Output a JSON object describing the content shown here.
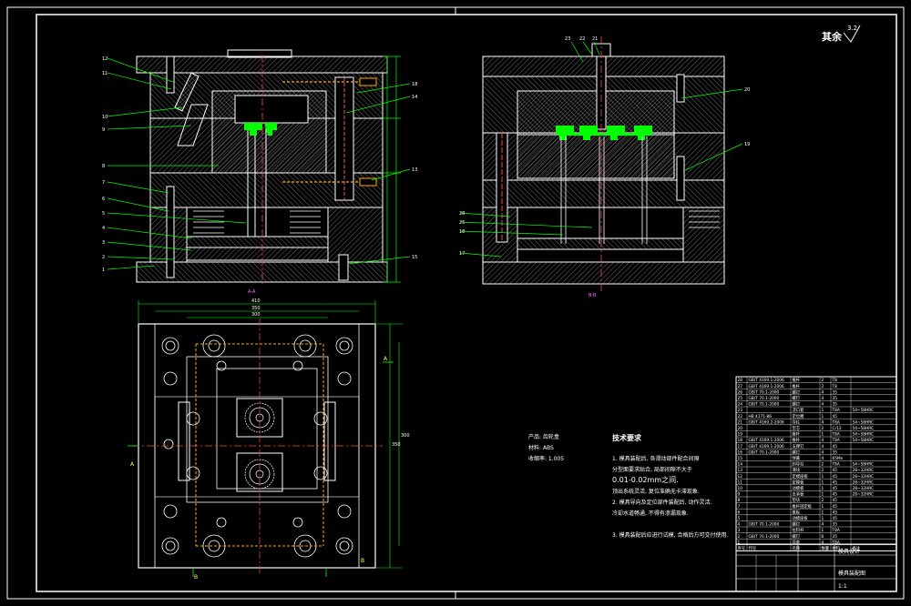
{
  "title_block": {
    "roughness_label": "其余",
    "roughness_value": "3.2",
    "dept": "模具设计",
    "drawing_name": "模具装配图",
    "scale": "1:1"
  },
  "product_info": {
    "product": "产品: 齿轮盒",
    "material": "材料: ABS",
    "shrink": "收缩率: 1.005"
  },
  "tech_req": {
    "heading": "技术要求",
    "lines": [
      "1. 模具装配后, 各滑动部件配合间隙",
      "分型面要求贴合, 局部间隙不大于",
      "0.01-0.02mm之间.",
      "顶出系统灵活, 复位准确无卡滞现象.",
      "2. 模具导向及定位部件装配后, 动作灵活.",
      "冷却水道畅通, 不得有渗漏现象.",
      "3. 模具装配后应进行试模, 合格后方可交付使用."
    ]
  },
  "views": {
    "section_a": "A-A",
    "section_b": "B-B",
    "marker_a": "A",
    "marker_b": "B"
  },
  "balloons_left": [
    "12",
    "11",
    "10",
    "9",
    "8",
    "7",
    "6",
    "5",
    "4",
    "3",
    "2",
    "1"
  ],
  "balloons_left_right": [
    "18",
    "14",
    "13",
    "15"
  ],
  "balloons_right_top": [
    "23",
    "22",
    "21"
  ],
  "balloons_right_side": [
    "20",
    "19"
  ],
  "balloons_right_left": [
    "28",
    "25",
    "18",
    "17"
  ],
  "dims": {
    "w1": "410",
    "w2": "350",
    "w3": "300",
    "h1": "350",
    "h2": "300"
  },
  "bom_rows": [
    [
      "28",
      "GB/T 4169.1-2006",
      "推杆",
      "2",
      "T8",
      ""
    ],
    [
      "27",
      "GB/T 4169.1-2006",
      "推杆",
      "2",
      "T8",
      ""
    ],
    [
      "26",
      "GB/T 70.1-2000",
      "螺钉",
      "4",
      "35",
      ""
    ],
    [
      "25",
      "GB/T 70.1-2000",
      "螺钉",
      "4",
      "35",
      ""
    ],
    [
      "24",
      "GB/T 70.1-2000",
      "螺钉",
      "4",
      "35",
      ""
    ],
    [
      "23",
      "",
      "浇口套",
      "1",
      "T8A",
      "54~58HRC"
    ],
    [
      "22",
      "HB 4171-86",
      "定位圈",
      "1",
      "45",
      ""
    ],
    [
      "21",
      "GB/T 4169.2-2006",
      "导柱",
      "4",
      "T8A",
      "54~58HRC"
    ],
    [
      "20",
      "",
      "型芯",
      "2",
      "Cr12",
      "54~58HRC"
    ],
    [
      "19",
      "",
      "推杆",
      "1",
      "T8A",
      "54~58HRC"
    ],
    [
      "18",
      "GB/T 4169.1-2006",
      "推杆",
      "4",
      "T8A",
      "54~58HRC"
    ],
    [
      "17",
      "GB/T 4169.1-2006",
      "支撑钉",
      "4",
      "45",
      ""
    ],
    [
      "16",
      "GB/T 70.1-2000",
      "螺钉",
      "4",
      "35",
      ""
    ],
    [
      "15",
      "",
      "弹簧",
      "4",
      "65Mn",
      ""
    ],
    [
      "14",
      "",
      "斜导柱",
      "2",
      "T8A",
      "54~58HRC"
    ],
    [
      "13",
      "",
      "滑块",
      "2",
      "45",
      "28~32HRC"
    ],
    [
      "12",
      "",
      "定模座板",
      "1",
      "45",
      "28~32HRC"
    ],
    [
      "11",
      "",
      "定模板",
      "1",
      "45",
      "28~32HRC"
    ],
    [
      "10",
      "",
      "动模板",
      "1",
      "45",
      "28~32HRC"
    ],
    [
      "9",
      "",
      "支承板",
      "1",
      "45",
      "28~32HRC"
    ],
    [
      "8",
      "",
      "垫块",
      "2",
      "45",
      ""
    ],
    [
      "7",
      "",
      "推杆固定板",
      "1",
      "45",
      ""
    ],
    [
      "6",
      "",
      "推板",
      "1",
      "45",
      ""
    ],
    [
      "5",
      "",
      "动模座板",
      "1",
      "45",
      ""
    ],
    [
      "4",
      "GB/T 70.1-2000",
      "螺钉",
      "4",
      "35",
      ""
    ],
    [
      "3",
      "",
      "拉料杆",
      "1",
      "T8A",
      ""
    ],
    [
      "2",
      "GB/T 70.1-2000",
      "螺钉",
      "6",
      "35",
      ""
    ],
    [
      "1",
      "",
      "导套",
      "4",
      "T8A",
      ""
    ]
  ],
  "bom_header": [
    "序号",
    "代号",
    "名称",
    "数量",
    "材料",
    "备注"
  ]
}
